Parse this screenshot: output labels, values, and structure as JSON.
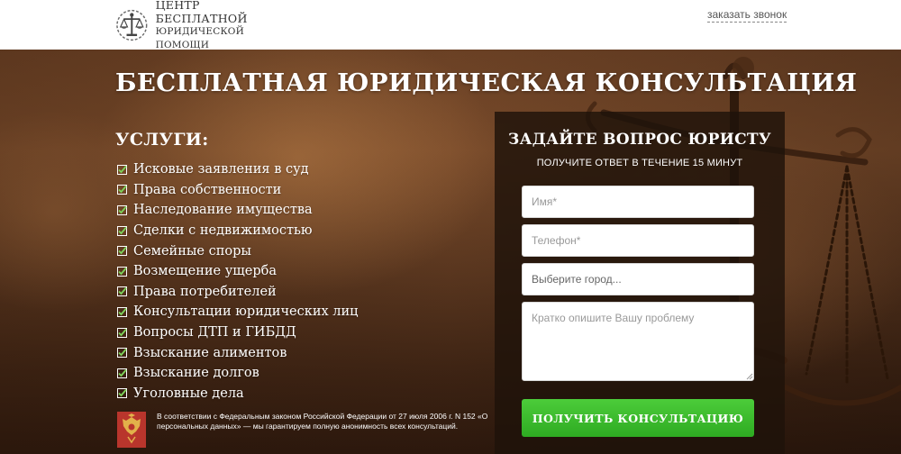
{
  "header": {
    "logo_line1": "ЦЕНТР БЕСПЛАТНОЙ",
    "logo_line2": "ЮРИДИЧЕСКОЙ ПОМОЩИ",
    "callback_label": "заказать звонок"
  },
  "hero": {
    "title": "БЕСПЛАТНАЯ ЮРИДИЧЕСКАЯ КОНСУЛЬТАЦИЯ"
  },
  "services": {
    "title": "УСЛУГИ:",
    "items": [
      "Исковые заявления в суд",
      "Права собственности",
      "Наследование имущества",
      "Сделки с недвижимостью",
      "Семейные споры",
      "Возмещение ущерба",
      "Права потребителей",
      "Консультации юридических лиц",
      "Вопросы ДТП и ГИБДД",
      "Взыскание алиментов",
      "Взыскание долгов",
      "Уголовные дела"
    ]
  },
  "privacy": {
    "text": "В соответствии с Федеральным законом Российской Федерации от 27 июля 2006 г. N 152 «О персональных данных» — мы гарантируем полную анонимность всех консультаций."
  },
  "form": {
    "title": "ЗАДАЙТЕ ВОПРОС ЮРИСТУ",
    "subtitle": "ПОЛУЧИТЕ ОТВЕТ В ТЕЧЕНИЕ 15 МИНУТ",
    "name_placeholder": "Имя*",
    "phone_placeholder": "Телефон*",
    "city_value": "Выберите город...",
    "problem_placeholder": "Кратко опишите Вашу проблему",
    "submit_label": "ПОЛУЧИТЬ КОНСУЛЬТАЦИЮ"
  },
  "colors": {
    "accent_green": "#3dbd2e",
    "panel_dark": "#1e120a",
    "check_green": "#6cc04a"
  },
  "icons": {
    "logo": "justice-emblem-icon",
    "list_marker": "checkbox-check-icon",
    "privacy": "russian-coat-of-arms-icon"
  }
}
